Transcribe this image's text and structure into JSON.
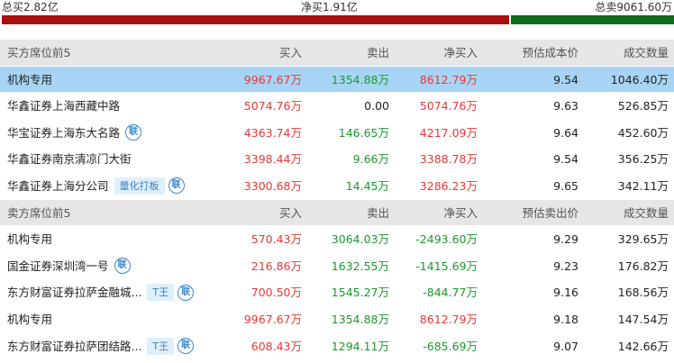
{
  "summary": {
    "total_buy": "总买2.82亿",
    "net_buy": "净买1.91亿",
    "total_sell": "总卖9061.60万",
    "buy_share": 0.755
  },
  "buy_section": {
    "headers": [
      "买方席位前5",
      "买入",
      "卖出",
      "净买入",
      "预估成本价",
      "成交数量"
    ],
    "rows": [
      {
        "name": "机构专用",
        "buy": "9967.67万",
        "sell": "1354.88万",
        "net": "8612.79万",
        "price": "9.54",
        "volume": "1046.40万"
      },
      {
        "name": "华鑫证券上海西藏中路",
        "buy": "5074.76万",
        "sell": "0.00",
        "net": "5074.76万",
        "price": "9.63",
        "volume": "526.85万"
      },
      {
        "name": "华宝证券上海东大名路",
        "lian": "联",
        "buy": "4363.74万",
        "sell": "146.65万",
        "net": "4217.09万",
        "price": "9.64",
        "volume": "452.60万"
      },
      {
        "name": "华鑫证券南京清凉门大街",
        "buy": "3398.44万",
        "sell": "9.66万",
        "net": "3388.78万",
        "price": "9.54",
        "volume": "356.25万"
      },
      {
        "name": "华鑫证券上海分公司",
        "tag": "量化打板",
        "lian": "联",
        "buy": "3300.68万",
        "sell": "14.45万",
        "net": "3286.23万",
        "price": "9.65",
        "volume": "342.11万"
      }
    ]
  },
  "sell_section": {
    "headers": [
      "卖方席位前5",
      "买入",
      "卖出",
      "净买入",
      "预估卖出价",
      "成交数量"
    ],
    "rows": [
      {
        "name": "机构专用",
        "buy": "570.43万",
        "sell": "3064.03万",
        "net": "-2493.60万",
        "price": "9.29",
        "volume": "329.65万"
      },
      {
        "name": "国金证券深圳湾一号",
        "lian": "联",
        "buy": "216.86万",
        "sell": "1632.55万",
        "net": "-1415.69万",
        "price": "9.23",
        "volume": "176.82万"
      },
      {
        "name": "东方财富证券拉萨金融城...",
        "tag": "T王",
        "lian": "联",
        "buy": "700.50万",
        "sell": "1545.27万",
        "net": "-844.77万",
        "price": "9.16",
        "volume": "168.56万"
      },
      {
        "name": "机构专用",
        "buy": "9967.67万",
        "sell": "1354.88万",
        "net": "8612.79万",
        "price": "9.18",
        "volume": "147.54万"
      },
      {
        "name": "东方财富证券拉萨团结路...",
        "tag": "T王",
        "lian": "联",
        "buy": "608.43万",
        "sell": "1294.11万",
        "net": "-685.69万",
        "price": "9.07",
        "volume": "142.66万"
      }
    ]
  },
  "colors": {
    "up": "#e53935",
    "down": "#1a9a2a",
    "bar_buy": "#a80f0f",
    "bar_sell": "#0d6b1c",
    "highlight": "#a7d4f5",
    "header_bg": "#e6e6e6",
    "tag": "#3a86c8"
  }
}
